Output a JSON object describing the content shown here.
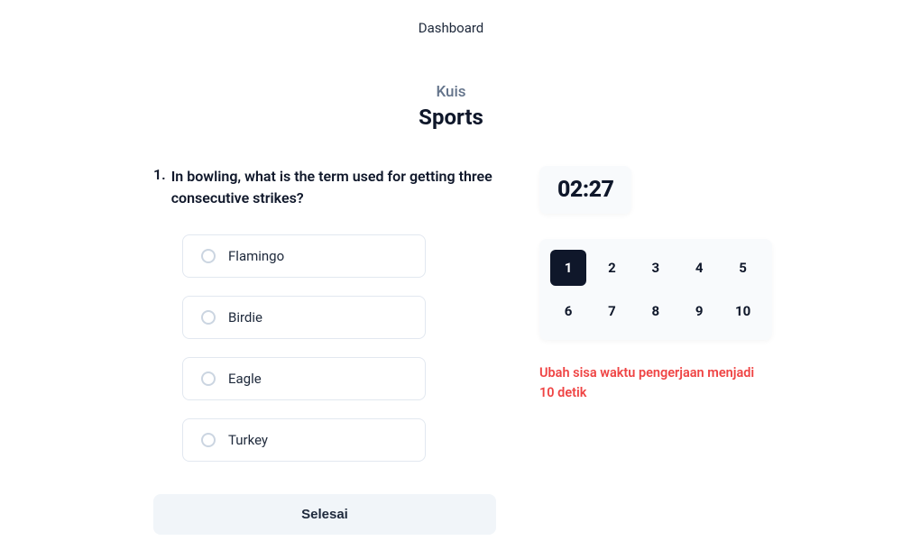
{
  "navbar": {
    "dashboard": "Dashboard"
  },
  "header": {
    "subtitle": "Kuis",
    "title": "Sports"
  },
  "question": {
    "number": "1.",
    "text": "In bowling, what is the term used for getting three consecutive strikes?"
  },
  "options": [
    "Flamingo",
    "Birdie",
    "Eagle",
    "Turkey"
  ],
  "finish_label": "Selesai",
  "timer": "02:27",
  "nav": {
    "items": [
      "1",
      "2",
      "3",
      "4",
      "5",
      "6",
      "7",
      "8",
      "9",
      "10"
    ],
    "active_index": 0
  },
  "cheat": "Ubah sisa waktu pengerjaan menjadi 10 detik"
}
